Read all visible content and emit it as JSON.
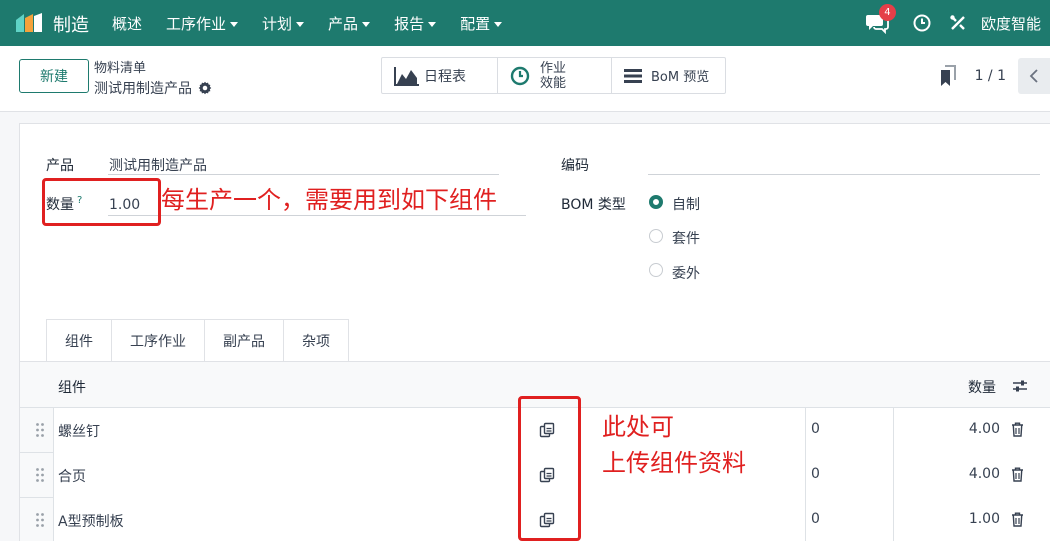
{
  "app": {
    "name": "制造"
  },
  "menu": [
    {
      "label": "概述",
      "dropdown": false
    },
    {
      "label": "工序作业",
      "dropdown": true
    },
    {
      "label": "计划",
      "dropdown": true
    },
    {
      "label": "产品",
      "dropdown": true
    },
    {
      "label": "报告",
      "dropdown": true
    },
    {
      "label": "配置",
      "dropdown": true
    }
  ],
  "systray": {
    "message_count": "4",
    "user_name": "欧度智能"
  },
  "control": {
    "new_label": "新建",
    "breadcrumb_parent": "物料清单",
    "breadcrumb_current": "测试用制造产品",
    "smart_buttons": {
      "schedule": "日程表",
      "efficiency_line1": "作业",
      "efficiency_line2": "效能",
      "bom_preview": "BoM 预览"
    },
    "pager": "1 / 1"
  },
  "form": {
    "product_label": "产品",
    "product_value": "测试用制造产品",
    "quantity_label": "数量",
    "quantity_help": "?",
    "quantity_value": "1.00",
    "code_label": "编码",
    "bom_type_label": "BOM 类型",
    "bom_type_options": [
      "自制",
      "套件",
      "委外"
    ],
    "bom_type_selected": "自制"
  },
  "annotations": {
    "quantity_note": "每生产一个，需要用到如下组件",
    "upload_note_line1": "此处可",
    "upload_note_line2": "上传组件资料"
  },
  "tabs": [
    "组件",
    "工序作业",
    "副产品",
    "杂项"
  ],
  "table": {
    "col_component": "组件",
    "col_quantity": "数量",
    "rows": [
      {
        "component": "螺丝钉",
        "col3": "0",
        "quantity": "4.00"
      },
      {
        "component": "合页",
        "col3": "0",
        "quantity": "4.00"
      },
      {
        "component": "A型预制板",
        "col3": "0",
        "quantity": "1.00"
      }
    ]
  },
  "colors": {
    "brand": "#1e7a6e",
    "annotation": "#e02020",
    "badge": "#e53f48"
  }
}
